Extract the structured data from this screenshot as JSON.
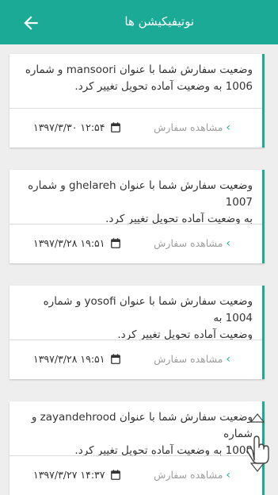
{
  "header": {
    "title": "نوتیفیکیشن ها",
    "back_icon": "arrow-left-icon"
  },
  "notifications": [
    {
      "line1": "وضعیت سفارش شما با عنوان mansoori و شماره",
      "line2": "1006 به وضعیت آماده تحویل تغییر کرد.",
      "view_label": "مشاهده سفارش",
      "date": "۱۳۹۷/۳/۳۰ ۱۲:۵۴"
    },
    {
      "line1": "وضعیت سفارش شما با عنوان ghelareh و شماره 1007",
      "line2": "به وضعیت آماده تحویل تغییر کرد.",
      "view_label": "مشاهده سفارش",
      "date": "۱۳۹۷/۳/۲۸ ۱۹:۵۱"
    },
    {
      "line1": "وضعیت سفارش شما با عنوان yosofi و شماره 1004 به",
      "line2": "وضعیت آماده تحویل تغییر کرد.",
      "view_label": "مشاهده سفارش",
      "date": "۱۳۹۷/۳/۲۸ ۱۹:۵۱"
    },
    {
      "line1": "وضعیت سفارش شما با عنوان zayandehrood و شماره",
      "line2": "1008 به وضعیت آماده تحویل تغییر کرد.",
      "view_label": "مشاهده سفارش",
      "date": "۱۳۹۷/۳/۲۷ ۱۴:۳۷"
    }
  ],
  "colors": {
    "accent": "#1aaa96",
    "background": "#eeeeee"
  }
}
